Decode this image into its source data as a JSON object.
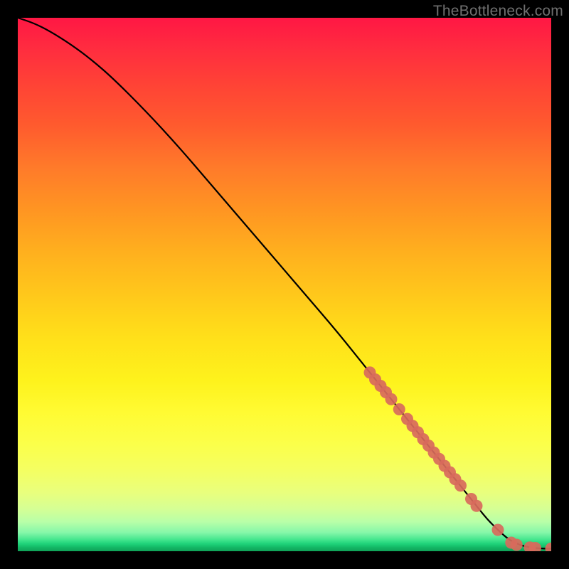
{
  "attribution": "TheBottleneck.com",
  "chart_data": {
    "type": "line",
    "title": "",
    "xlabel": "",
    "ylabel": "",
    "xlim": [
      0,
      100
    ],
    "ylim": [
      0,
      100
    ],
    "curve": {
      "name": "bottleneck-curve",
      "x": [
        0,
        3,
        6,
        10,
        14,
        18,
        24,
        30,
        36,
        42,
        48,
        54,
        60,
        66,
        70,
        74,
        78,
        82,
        86,
        88,
        90,
        92,
        94,
        96,
        98,
        100
      ],
      "y": [
        100,
        99,
        97.5,
        95,
        92,
        88.5,
        82.5,
        76,
        69,
        62,
        55,
        48,
        41,
        33.5,
        28.5,
        23.5,
        18.5,
        13.5,
        8.5,
        6,
        4,
        2.2,
        1.2,
        0.7,
        0.5,
        0.5
      ]
    },
    "markers": {
      "name": "highlighted-points",
      "color": "#d86a5c",
      "points": [
        {
          "x": 66,
          "y": 33.5
        },
        {
          "x": 67,
          "y": 32.2
        },
        {
          "x": 68,
          "y": 31.0
        },
        {
          "x": 69,
          "y": 29.8
        },
        {
          "x": 70,
          "y": 28.5
        },
        {
          "x": 71.5,
          "y": 26.6
        },
        {
          "x": 73,
          "y": 24.8
        },
        {
          "x": 74,
          "y": 23.5
        },
        {
          "x": 75,
          "y": 22.3
        },
        {
          "x": 76,
          "y": 21.0
        },
        {
          "x": 77,
          "y": 19.8
        },
        {
          "x": 78,
          "y": 18.5
        },
        {
          "x": 79,
          "y": 17.3
        },
        {
          "x": 80,
          "y": 16.0
        },
        {
          "x": 81,
          "y": 14.8
        },
        {
          "x": 82,
          "y": 13.5
        },
        {
          "x": 83,
          "y": 12.3
        },
        {
          "x": 85,
          "y": 9.8
        },
        {
          "x": 86,
          "y": 8.5
        },
        {
          "x": 90,
          "y": 4.0
        },
        {
          "x": 92.5,
          "y": 1.6
        },
        {
          "x": 93.5,
          "y": 1.2
        },
        {
          "x": 96,
          "y": 0.7
        },
        {
          "x": 97,
          "y": 0.6
        },
        {
          "x": 100,
          "y": 0.5
        }
      ]
    }
  }
}
